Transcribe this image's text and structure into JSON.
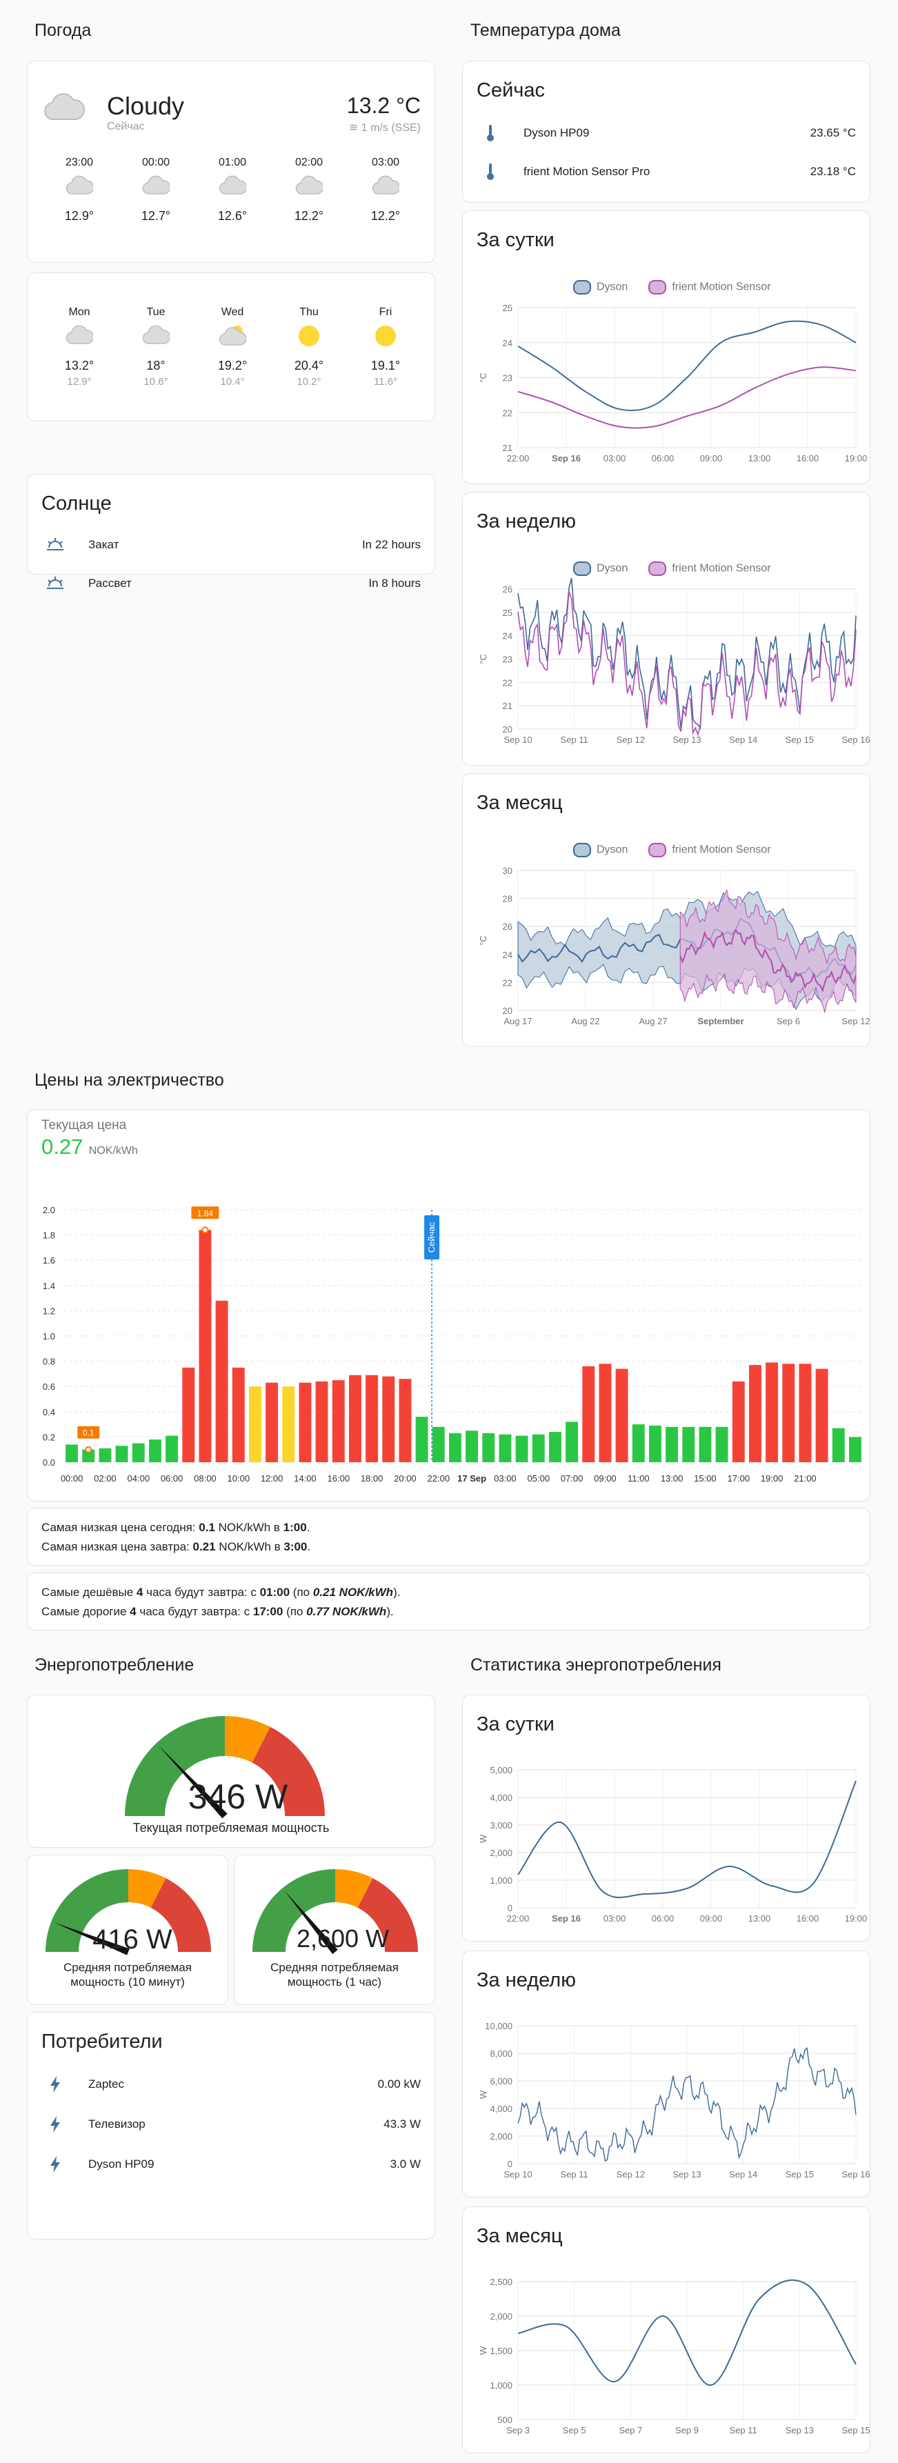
{
  "weather": {
    "section_title": "Погода",
    "condition": "Cloudy",
    "subtitle": "Сейчас",
    "temperature": "13.2 °C",
    "wind": "1 m/s (SSE)",
    "hourly": [
      {
        "time": "23:00",
        "temp": "12.9°",
        "icon": "cloud-icon"
      },
      {
        "time": "00:00",
        "temp": "12.7°",
        "icon": "cloud-icon"
      },
      {
        "time": "01:00",
        "temp": "12.6°",
        "icon": "cloud-icon"
      },
      {
        "time": "02:00",
        "temp": "12.2°",
        "icon": "cloud-icon"
      },
      {
        "time": "03:00",
        "temp": "12.2°",
        "icon": "cloud-icon"
      }
    ],
    "daily": [
      {
        "day": "Mon",
        "high": "13.2°",
        "low": "12.9°",
        "icon": "cloud-icon"
      },
      {
        "day": "Tue",
        "high": "18°",
        "low": "10.6°",
        "icon": "cloud-icon"
      },
      {
        "day": "Wed",
        "high": "19.2°",
        "low": "10.4°",
        "icon": "partly-cloudy-icon"
      },
      {
        "day": "Thu",
        "high": "20.4°",
        "low": "10.2°",
        "icon": "sun-icon"
      },
      {
        "day": "Fri",
        "high": "19.1°",
        "low": "11.6°",
        "icon": "sun-icon"
      }
    ]
  },
  "sun": {
    "title": "Солнце",
    "rows": [
      {
        "label": "Закат",
        "value": "In 22 hours",
        "icon": "sunset-icon"
      },
      {
        "label": "Рассвет",
        "value": "In 8 hours",
        "icon": "sunrise-icon"
      }
    ]
  },
  "home_temp": {
    "section_title": "Температура дома",
    "now_title": "Сейчас",
    "sensors": [
      {
        "label": "Dyson HP09",
        "value": "23.65 °C",
        "icon": "thermometer-icon"
      },
      {
        "label": "frient Motion Sensor Pro",
        "value": "23.18 °C",
        "icon": "thermometer-icon"
      }
    ],
    "legend": [
      "Dyson",
      "frient Motion Sensor"
    ],
    "colors": {
      "dyson": "#3b6a9a",
      "frient": "#b04fb3",
      "dyson_fill": "#b7c6d8",
      "frient_fill": "#d9b3db"
    },
    "ylabel": "°C",
    "day": {
      "title": "За сутки",
      "ticks_y": [
        "25",
        "24",
        "23",
        "22",
        "21"
      ],
      "ticks_x": [
        "22:00",
        "Sep 16",
        "03:00",
        "06:00",
        "09:00",
        "13:00",
        "16:00",
        "19:00"
      ]
    },
    "week": {
      "title": "За неделю",
      "ticks_y": [
        "26",
        "25",
        "24",
        "23",
        "22",
        "21",
        "20"
      ],
      "ticks_x": [
        "Sep 10",
        "Sep 11",
        "Sep 12",
        "Sep 13",
        "Sep 14",
        "Sep 15",
        "Sep 16"
      ]
    },
    "month": {
      "title": "За месяц",
      "ticks_y": [
        "30",
        "28",
        "26",
        "24",
        "22",
        "20"
      ],
      "ticks_x": [
        "Aug 17",
        "Aug 22",
        "Aug 27",
        "September",
        "Sep 6",
        "Sep 12"
      ]
    }
  },
  "price": {
    "section_title": "Цены на электричество",
    "current_label": "Текущая цена",
    "current_value": "0.27",
    "current_unit": "NOK/kWh",
    "now_label": "Сейчас",
    "min_label": "0.1",
    "max_label": "1.84",
    "info1": {
      "p1": "Самая низкая цена сегодня: ",
      "v1": "0.1",
      "p2": " NOK/kWh в ",
      "t1": "1:00",
      "p3": "."
    },
    "info2": {
      "p1": "Самая низкая цена завтра: ",
      "v1": "0.21",
      "p2": " NOK/kWh в ",
      "t1": "3:00",
      "p3": "."
    },
    "info3": {
      "p1": "Самые дешёвые ",
      "n": "4",
      "p2": " часа будут завтра: с ",
      "t": "01:00",
      "p3": " (по ",
      "v": "0.21 NOK/kWh",
      "p4": ")."
    },
    "info4": {
      "p1": "Самые дорогие ",
      "n": "4",
      "p2": " часа будут завтра: с ",
      "t": "17:00",
      "p3": " (по ",
      "v": "0.77 NOK/kWh",
      "p4": ")."
    },
    "colors": {
      "green": "#2bc744",
      "yellow": "#fcd52a",
      "red": "#f44336",
      "current": "#2bc744",
      "now_line": "#1e88e5"
    }
  },
  "energy": {
    "section_title": "Энергопотребление",
    "gauge_main": {
      "value": "346 W",
      "label": "Текущая потребляемая мощность",
      "fraction": 0.26
    },
    "gauge_10": {
      "value": "416 W",
      "label": "Средняя потребляемая мощность (10 минут)",
      "fraction": 0.12
    },
    "gauge_1h": {
      "value": "2,600 W",
      "label": "Средняя потребляемая мощность (1 час)",
      "fraction": 0.28
    },
    "consumers_title": "Потребители",
    "consumers": [
      {
        "label": "Zaptec",
        "value": "0.00 kW",
        "icon": "lightning-icon"
      },
      {
        "label": "Телевизор",
        "value": "43.3 W",
        "icon": "lightning-icon"
      },
      {
        "label": "Dyson HP09",
        "value": "3.0 W",
        "icon": "lightning-icon"
      }
    ]
  },
  "energy_stats": {
    "section_title": "Статистика энергопотребления",
    "ylabel": "W",
    "day": {
      "title": "За сутки",
      "ticks_y": [
        "5,000",
        "4,000",
        "3,000",
        "2,000",
        "1,000",
        "0"
      ],
      "ticks_x": [
        "22:00",
        "Sep 16",
        "03:00",
        "06:00",
        "09:00",
        "13:00",
        "16:00",
        "19:00"
      ]
    },
    "week": {
      "title": "За неделю",
      "ticks_y": [
        "10,000",
        "8,000",
        "6,000",
        "4,000",
        "2,000",
        "0"
      ],
      "ticks_x": [
        "Sep 10",
        "Sep 11",
        "Sep 12",
        "Sep 13",
        "Sep 14",
        "Sep 15",
        "Sep 16"
      ]
    },
    "month": {
      "title": "За месяц",
      "ticks_y": [
        "2,500",
        "2,000",
        "1,500",
        "1,000",
        "500"
      ],
      "ticks_x": [
        "Sep 3",
        "Sep 5",
        "Sep 7",
        "Sep 9",
        "Sep 11",
        "Sep 13",
        "Sep 15"
      ]
    }
  },
  "chart_data": [
    {
      "type": "line",
      "title": "За сутки",
      "ylabel": "°C",
      "ylim": [
        21,
        25
      ],
      "series": [
        {
          "name": "Dyson",
          "x": [
            "22:00",
            "00:00",
            "03:00",
            "06:00",
            "08:00",
            "10:00",
            "13:00",
            "16:00",
            "18:00",
            "20:00",
            "21:00"
          ],
          "values": [
            23.9,
            23.3,
            22.6,
            22.1,
            22.2,
            23.0,
            24.0,
            24.3,
            24.6,
            24.5,
            24.0
          ]
        },
        {
          "name": "frient Motion Sensor",
          "x": [
            "22:00",
            "00:00",
            "03:00",
            "06:00",
            "08:00",
            "10:00",
            "13:00",
            "16:00",
            "18:00",
            "20:00",
            "21:00"
          ],
          "values": [
            22.6,
            22.3,
            21.9,
            21.6,
            21.6,
            21.9,
            22.2,
            22.7,
            23.1,
            23.3,
            23.2
          ]
        }
      ]
    },
    {
      "type": "line",
      "title": "За неделю",
      "ylabel": "°C",
      "ylim": [
        20,
        26
      ],
      "series": [
        {
          "name": "Dyson",
          "x": [
            "Sep 10",
            "Sep 11",
            "Sep 12",
            "Sep 13",
            "Sep 14",
            "Sep 15",
            "Sep 16"
          ],
          "values": [
            24.2,
            24.8,
            22.8,
            21.0,
            22.8,
            22.4,
            24.0
          ]
        },
        {
          "name": "frient Motion Sensor",
          "x": [
            "Sep 10",
            "Sep 11",
            "Sep 12",
            "Sep 13",
            "Sep 14",
            "Sep 15",
            "Sep 16"
          ],
          "values": [
            23.4,
            24.3,
            22.2,
            20.8,
            22.0,
            22.0,
            23.0
          ]
        }
      ]
    },
    {
      "type": "area",
      "title": "За месяц",
      "ylabel": "°C",
      "ylim": [
        20,
        30
      ],
      "series": [
        {
          "name": "Dyson",
          "x": [
            "Aug 17",
            "Aug 22",
            "Aug 27",
            "September",
            "Sep 6",
            "Sep 12",
            "Sep 16"
          ],
          "values": [
            24.3,
            23.8,
            24.6,
            24.8,
            26.0,
            22.5,
            23.2
          ],
          "min": [
            22.5,
            22.3,
            22.8,
            22.0,
            22.5,
            21.0,
            21.5
          ],
          "max": [
            25.8,
            25.3,
            26.0,
            27.0,
            28.5,
            25.5,
            24.8
          ]
        },
        {
          "name": "frient Motion Sensor",
          "x": [
            "September",
            "Sep 6",
            "Sep 12",
            "Sep 16"
          ],
          "values": [
            24.2,
            25.5,
            22.0,
            22.5
          ],
          "min": [
            21.5,
            22.0,
            20.8,
            21.0
          ],
          "max": [
            26.5,
            28.0,
            24.5,
            24.0
          ]
        }
      ]
    },
    {
      "type": "bar",
      "title": "Цены на электричество",
      "ylabel": "NOK/kWh",
      "ylim": [
        0,
        2.0
      ],
      "x": [
        "00:00",
        "01:00",
        "02:00",
        "03:00",
        "04:00",
        "05:00",
        "06:00",
        "07:00",
        "08:00",
        "09:00",
        "10:00",
        "11:00",
        "12:00",
        "13:00",
        "14:00",
        "15:00",
        "16:00",
        "17:00",
        "18:00",
        "19:00",
        "20:00",
        "21:00",
        "22:00",
        "23:00",
        "17 Sep",
        "01:00",
        "02:00",
        "03:00",
        "04:00",
        "05:00",
        "06:00",
        "07:00",
        "08:00",
        "09:00",
        "10:00",
        "11:00",
        "12:00",
        "13:00",
        "14:00",
        "15:00",
        "16:00",
        "17:00",
        "18:00",
        "19:00",
        "20:00",
        "21:00",
        "22:00",
        "23:00"
      ],
      "values": [
        0.14,
        0.1,
        0.11,
        0.13,
        0.15,
        0.18,
        0.21,
        0.75,
        1.84,
        1.28,
        0.75,
        0.6,
        0.63,
        0.6,
        0.63,
        0.64,
        0.65,
        0.69,
        0.69,
        0.68,
        0.66,
        0.36,
        0.28,
        0.23,
        0.25,
        0.23,
        0.22,
        0.21,
        0.22,
        0.24,
        0.32,
        0.76,
        0.78,
        0.74,
        0.3,
        0.29,
        0.28,
        0.28,
        0.28,
        0.28,
        0.64,
        0.77,
        0.79,
        0.78,
        0.78,
        0.74,
        0.27,
        0.2
      ],
      "levels": [
        "g",
        "g",
        "g",
        "g",
        "g",
        "g",
        "g",
        "r",
        "r",
        "r",
        "r",
        "y",
        "r",
        "y",
        "r",
        "r",
        "r",
        "r",
        "r",
        "r",
        "r",
        "g",
        "g",
        "g",
        "g",
        "g",
        "g",
        "g",
        "g",
        "g",
        "g",
        "r",
        "r",
        "r",
        "g",
        "g",
        "g",
        "g",
        "g",
        "g",
        "r",
        "r",
        "r",
        "r",
        "r",
        "r",
        "g",
        "g"
      ],
      "ticks_y": [
        "2.0",
        "1.8",
        "1.6",
        "1.4",
        "1.2",
        "1.0",
        "0.8",
        "0.6",
        "0.4",
        "0.2",
        "0.0"
      ],
      "ticks_x": [
        "00:00",
        "02:00",
        "04:00",
        "06:00",
        "08:00",
        "10:00",
        "12:00",
        "14:00",
        "16:00",
        "18:00",
        "20:00",
        "22:00",
        "17 Sep",
        "03:00",
        "05:00",
        "07:00",
        "09:00",
        "11:00",
        "13:00",
        "15:00",
        "17:00",
        "19:00",
        "21:00"
      ]
    },
    {
      "type": "line",
      "title": "За сутки",
      "ylabel": "W",
      "ylim": [
        0,
        5000
      ],
      "series": [
        {
          "x": [
            "22:00",
            "Sep 16",
            "03:00",
            "06:00",
            "09:00",
            "13:00",
            "16:00",
            "19:00",
            "21:00"
          ],
          "values": [
            1200,
            3100,
            600,
            500,
            700,
            1500,
            800,
            900,
            4600
          ]
        }
      ]
    },
    {
      "type": "line",
      "title": "За неделю",
      "ylabel": "W",
      "ylim": [
        0,
        10000
      ],
      "series": [
        {
          "x": [
            "Sep 10",
            "Sep 11",
            "Sep 12",
            "Sep 13",
            "Sep 14",
            "Sep 15",
            "Sep 16"
          ],
          "values": [
            4200,
            1200,
            1400,
            6300,
            1200,
            7900,
            4500
          ]
        }
      ]
    },
    {
      "type": "line",
      "title": "За месяц",
      "ylabel": "W",
      "ylim": [
        500,
        2500
      ],
      "series": [
        {
          "x": [
            "Sep 3",
            "Sep 5",
            "Sep 7",
            "Sep 9",
            "Sep 11",
            "Sep 13",
            "Sep 15",
            "Sep 16"
          ],
          "values": [
            1750,
            1850,
            1050,
            2000,
            1000,
            2250,
            2450,
            1300
          ]
        }
      ]
    }
  ]
}
